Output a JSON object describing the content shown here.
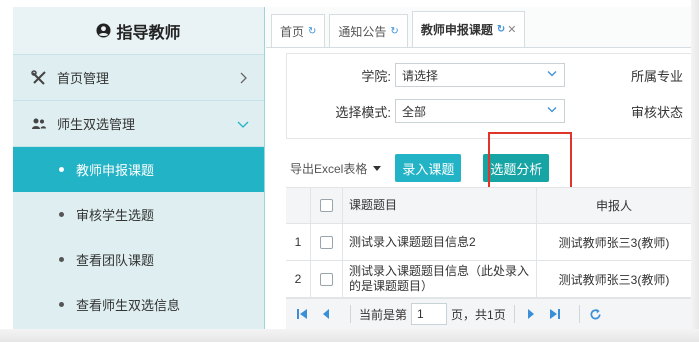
{
  "sidebar": {
    "title": "指导教师",
    "menu": [
      {
        "label": "首页管理"
      },
      {
        "label": "师生双选管理"
      }
    ],
    "submenu": [
      {
        "label": "教师申报课题"
      },
      {
        "label": "审核学生选题"
      },
      {
        "label": "查看团队课题"
      },
      {
        "label": "查看师生双选信息"
      }
    ]
  },
  "tabs": [
    {
      "label": "首页"
    },
    {
      "label": "通知公告"
    },
    {
      "label": "教师申报课题"
    }
  ],
  "filters": {
    "college_label": "学院:",
    "college_value": "请选择",
    "mode_label": "选择模式:",
    "mode_value": "全部",
    "dept_label": "所属专业",
    "review_label": "审核状态"
  },
  "toolbar": {
    "export_label": "导出Excel表格",
    "enter_button": "录入课题",
    "analysis_button": "选题分析"
  },
  "table": {
    "headers": {
      "title": "课题题目",
      "reporter": "申报人"
    },
    "rows": [
      {
        "num": "1",
        "title": "测试录入课题题目信息2",
        "reporter": "测试教师张三3(教师)"
      },
      {
        "num": "2",
        "title": "测试录入课题题目信息（此处录入的是课题题目）",
        "reporter": "测试教师张三3(教师)"
      }
    ]
  },
  "pager": {
    "prefix": "当前是第",
    "page": "1",
    "suffix": "页，共1页"
  },
  "colors": {
    "accent": "#22b3c6",
    "analysis": "#17a4a5",
    "highlight": "#e0352b",
    "sidebar_bg": "#dfeff1"
  }
}
